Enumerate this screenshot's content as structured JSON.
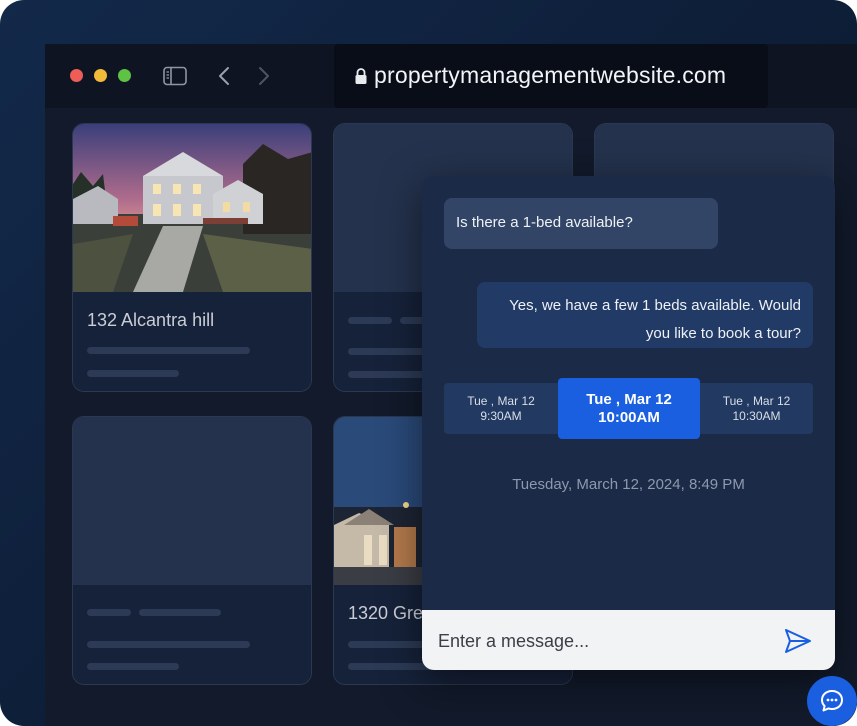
{
  "browser": {
    "url": "propertymanagementwebsite.com"
  },
  "listings": [
    {
      "title": "132 Alcantra hill"
    },
    {
      "title": "1320 Gre"
    }
  ],
  "chat": {
    "incoming_message": "Is there a 1-bed available?",
    "reply_message": "Yes, we have a few 1 beds available.  Would you like to book a tour?",
    "time_slots": [
      {
        "date": "Tue , Mar 12",
        "time": "9:30AM"
      },
      {
        "date": "Tue , Mar 12",
        "time": "10:00AM"
      },
      {
        "date": "Tue , Mar 12",
        "time": "10:30AM"
      }
    ],
    "selected_slot_index": 1,
    "timestamp": "Tuesday, March 12, 2024, 8:49 PM",
    "input_placeholder": "Enter a message..."
  },
  "colors": {
    "accent": "#1a5fe0",
    "background": "#0e1f3a"
  },
  "icons": [
    "sidebar-toggle-icon",
    "back-arrow-icon",
    "forward-arrow-icon",
    "lock-icon",
    "send-icon",
    "chat-bubble-icon"
  ]
}
